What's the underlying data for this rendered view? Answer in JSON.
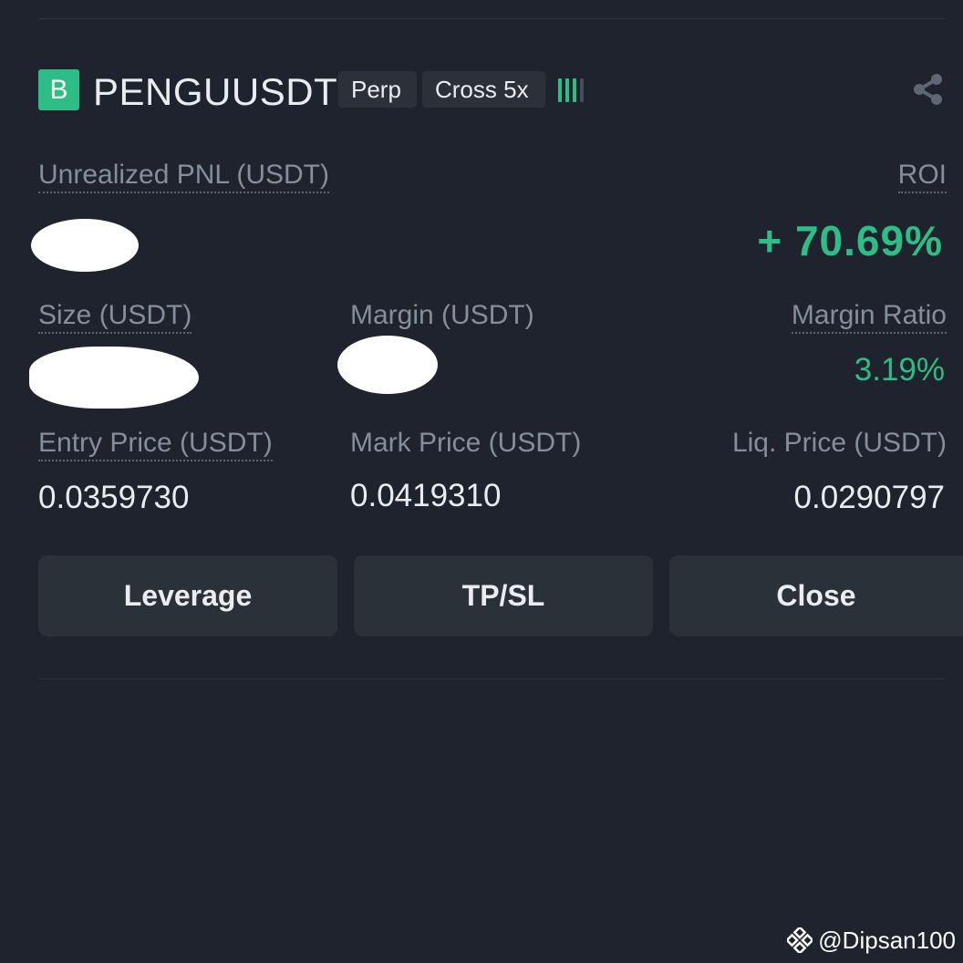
{
  "position": {
    "side_badge": "B",
    "symbol": "PENGUUSDT",
    "tags": [
      "Perp",
      "Cross 5x"
    ],
    "risk_indicator": "margin-ratio-bars-icon",
    "share_icon": "share-icon"
  },
  "stats": {
    "unrealized_pnl_label": "Unrealized PNL (USDT)",
    "roi_label": "ROI",
    "roi_value": "+ 70.69%",
    "size_label": "Size (USDT)",
    "margin_label": "Margin (USDT)",
    "margin_ratio_label": "Margin Ratio",
    "margin_ratio_value": "3.19%",
    "entry_price_label": "Entry Price (USDT)",
    "entry_price_value": "0.0359730",
    "mark_price_label": "Mark Price (USDT)",
    "mark_price_value": "0.0419310",
    "liq_price_label": "Liq. Price (USDT)",
    "liq_price_value": "0.0290797"
  },
  "actions": {
    "leverage": "Leverage",
    "tpsl": "TP/SL",
    "close": "Close"
  },
  "watermark": "@Dipsan100",
  "colors": {
    "background": "#1f232d",
    "positive": "#2ebd85",
    "button": "#2b3139",
    "muted_text": "#848e9c"
  }
}
